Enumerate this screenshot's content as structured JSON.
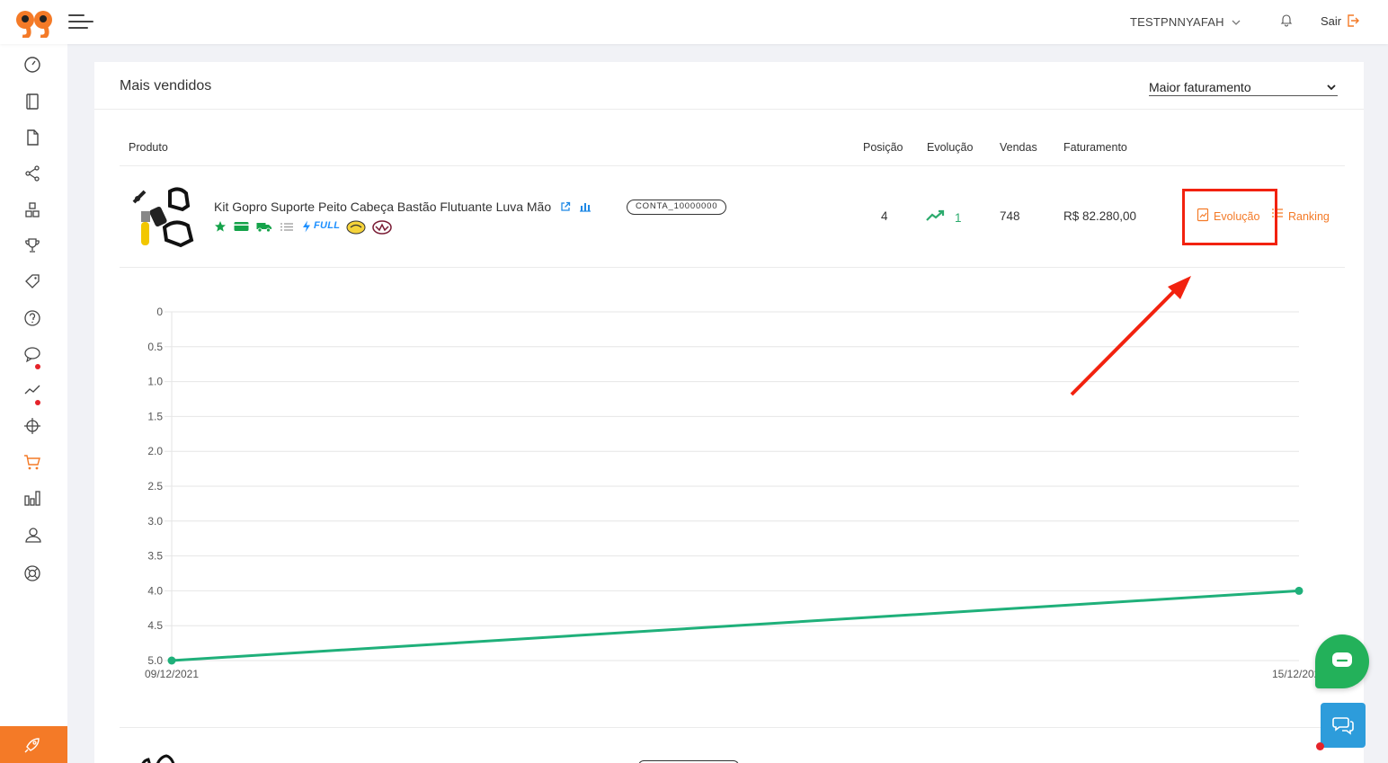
{
  "header": {
    "user_name": "TESTPNNYAFAH",
    "logout_label": "Sair"
  },
  "sidebar": {
    "items": [
      {
        "icon": "speedometer-icon"
      },
      {
        "icon": "notebook-icon"
      },
      {
        "icon": "document-icon"
      },
      {
        "icon": "share-icon"
      },
      {
        "icon": "boxes-icon"
      },
      {
        "icon": "trophy-icon"
      },
      {
        "icon": "tag-icon"
      },
      {
        "icon": "help-icon"
      },
      {
        "icon": "chat-icon"
      },
      {
        "icon": "trend-icon"
      },
      {
        "icon": "crosshair-icon"
      },
      {
        "icon": "cart-icon",
        "active": true
      },
      {
        "icon": "bar-chart-icon"
      },
      {
        "icon": "users-icon"
      },
      {
        "icon": "lifebuoy-icon"
      }
    ],
    "bottom_icon": "rocket-icon"
  },
  "card": {
    "title": "Mais vendidos",
    "sort_select": {
      "selected": "Maior faturamento"
    },
    "columns": [
      "Produto",
      "Posição",
      "Evolução",
      "Vendas",
      "Faturamento"
    ],
    "rows": [
      {
        "product_name": "Kit Gopro Suporte Peito Cabeça Bastão Flutuante Luva Mão",
        "badges": [
          "star-icon",
          "card-icon",
          "truck-icon",
          "list-icon",
          "full-bolt-icon"
        ],
        "full_label": "FULL",
        "account": "CONTA_10000000",
        "position": "4",
        "evolution": "1",
        "sales": "748",
        "revenue": "R$ 82.280,00",
        "action_evolution": "Evolução",
        "action_ranking": "Ranking"
      }
    ]
  },
  "colors": {
    "accent": "#f47a27",
    "series": "#1fb07a",
    "highlight_box": "#f2220f"
  },
  "chart_data": {
    "type": "line",
    "x": [
      "09/12/2021",
      "15/12/2021"
    ],
    "series": [
      {
        "values": [
          5.0,
          4.0
        ]
      }
    ],
    "y_ticks": [
      "0",
      "0.5",
      "1.0",
      "1.5",
      "2.0",
      "2.5",
      "3.0",
      "3.5",
      "4.0",
      "4.5",
      "5.0"
    ],
    "ylim": [
      0,
      5
    ],
    "y_reversed": true,
    "grid": true,
    "legend": "none"
  }
}
